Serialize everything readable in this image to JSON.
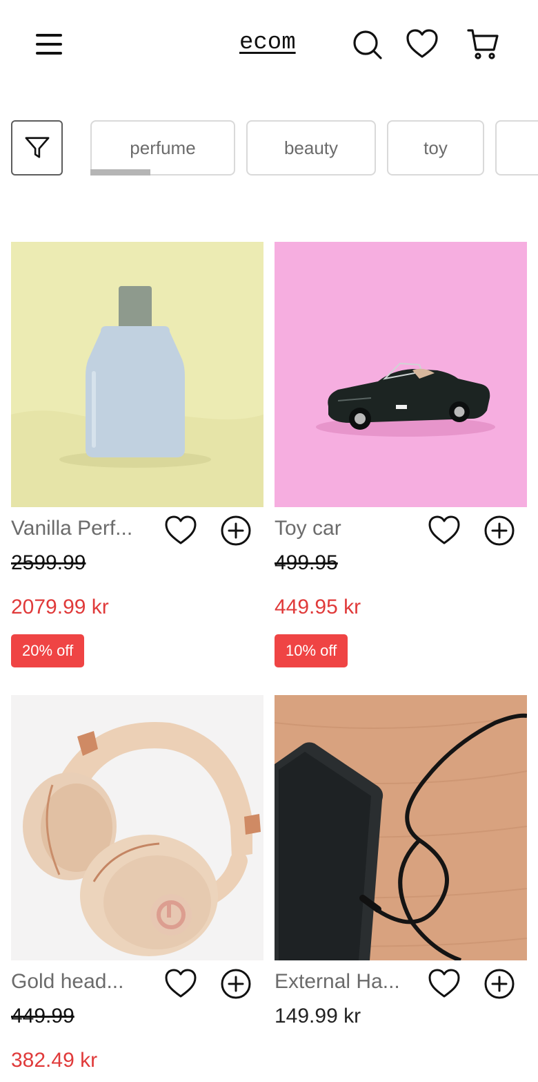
{
  "header": {
    "brand": "ecom",
    "icons": [
      "menu-icon",
      "search-icon",
      "heart-icon",
      "cart-icon"
    ]
  },
  "filters": {
    "filter_icon": "funnel-icon",
    "chips": [
      "perfume",
      "beauty",
      "toy",
      ""
    ]
  },
  "products": [
    {
      "name": "Vanilla Perf...",
      "original_price": "2599.99",
      "price": "2079.99 kr",
      "discount": "20% off"
    },
    {
      "name": "Toy car",
      "original_price": "499.95",
      "price": "449.95 kr",
      "discount": "10% off"
    },
    {
      "name": "Gold head...",
      "original_price": "449.99",
      "price": "382.49 kr",
      "discount": ""
    },
    {
      "name": "External Ha...",
      "original_price": "",
      "price": "149.99 kr",
      "discount": ""
    }
  ],
  "colors": {
    "sale_price": "#e03a3a",
    "badge": "#ef4444",
    "name_gray": "#6b6b6b"
  }
}
